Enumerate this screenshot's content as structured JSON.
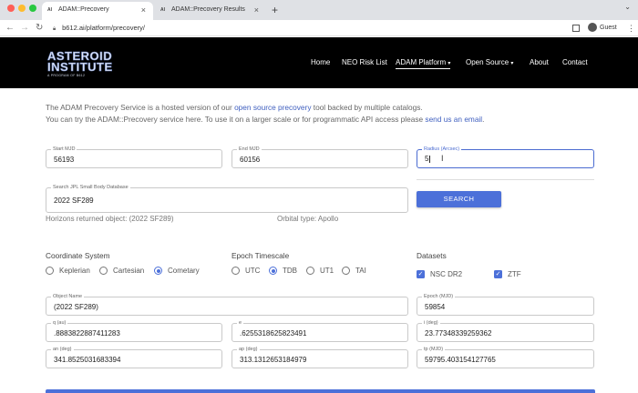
{
  "browser": {
    "tabs": [
      {
        "title": "ADAM::Precovery",
        "active": true
      },
      {
        "title": "ADAM::Precovery Results",
        "active": false
      }
    ],
    "new_tab_label": "+",
    "url": "b612.ai/platform/precovery/",
    "profile": "Guest"
  },
  "site": {
    "logo": {
      "line1": "ASTEROID",
      "line2": "INSTITUTE",
      "tagline": "A PROGRAM OF B612"
    },
    "nav": [
      {
        "label": "Home"
      },
      {
        "label": "NEO Risk List"
      },
      {
        "label": "ADAM Platform",
        "dropdown": true,
        "active": true
      },
      {
        "label": "Open Source",
        "dropdown": true
      },
      {
        "label": "About"
      },
      {
        "label": "Contact"
      }
    ]
  },
  "intro": {
    "line1_prefix": "The ADAM Precovery Service is a hosted version of our ",
    "line1_link": "open source precovery",
    "line1_suffix": " tool backed by multiple catalogs.",
    "line2_prefix": "You can try the ADAM::Precovery service here. To use it on a larger scale or for programmatic API access please ",
    "line2_link": "send us an email",
    "line2_suffix": "."
  },
  "form": {
    "start_mjd": {
      "label": "Start MJD",
      "value": "56193"
    },
    "end_mjd": {
      "label": "End MJD",
      "value": "60156"
    },
    "radius": {
      "label": "Radius (Arcsec)",
      "value": "5"
    },
    "search_field": {
      "label": "Search JPL Small Body Database",
      "value": "2022 SF289"
    },
    "search_button": "SEARCH",
    "horizons_text": "Horizons returned object: (2022 SF289)",
    "orbital_type": "Orbital type: Apollo",
    "coordinate_system": {
      "title": "Coordinate System",
      "options": [
        "Keplerian",
        "Cartesian",
        "Cometary"
      ],
      "selected": "Cometary"
    },
    "epoch_timescale": {
      "title": "Epoch Timescale",
      "options": [
        "UTC",
        "TDB",
        "UT1",
        "TAI"
      ],
      "selected": "TDB"
    },
    "datasets": {
      "title": "Datasets",
      "options": [
        "NSC DR2",
        "ZTF"
      ],
      "checked": [
        "NSC DR2",
        "ZTF"
      ]
    },
    "object_name": {
      "label": "Object Name",
      "value": "(2022 SF289)"
    },
    "epoch_mjd": {
      "label": "Epoch (MJD)",
      "value": "59854"
    },
    "q": {
      "label": "q (au)",
      "value": ".8883822887411283"
    },
    "e": {
      "label": "e",
      "value": ".6255318625823491"
    },
    "i": {
      "label": "i (deg)",
      "value": "23.77348339259362"
    },
    "an": {
      "label": "an (deg)",
      "value": "341.8525031683394"
    },
    "ap": {
      "label": "ap (deg)",
      "value": "313.1312653184979"
    },
    "tp": {
      "label": "tp (MJD)",
      "value": "59795.403154127765"
    }
  },
  "colors": {
    "accent": "#4c70d9",
    "header_bg": "#000000"
  }
}
